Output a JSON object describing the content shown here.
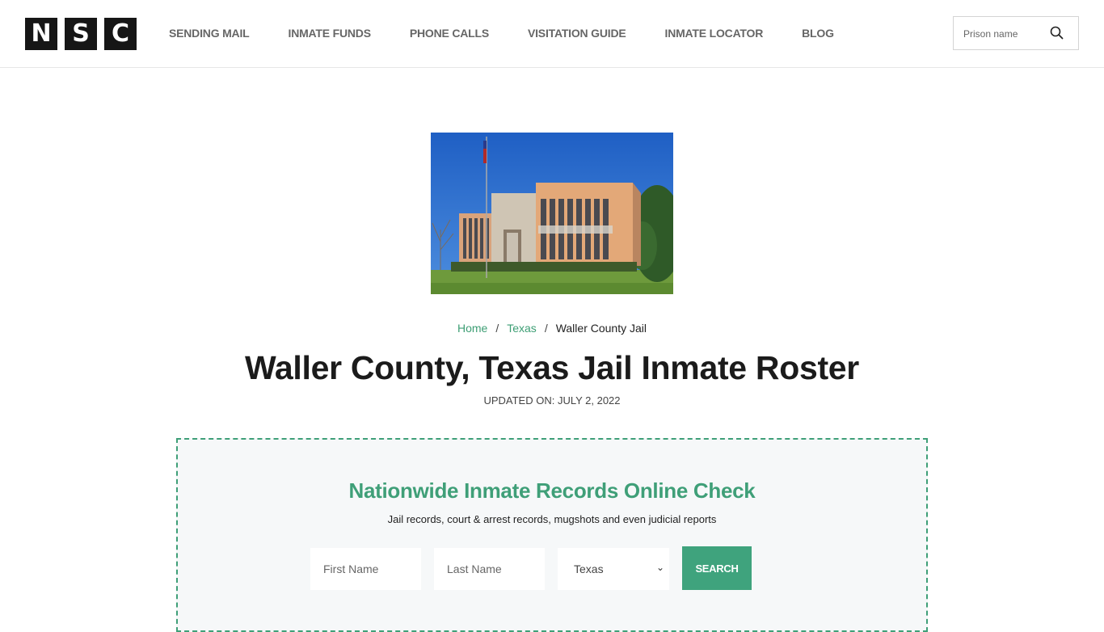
{
  "header": {
    "logo_letters": [
      "N",
      "S",
      "C"
    ],
    "nav": [
      {
        "label": "SENDING MAIL"
      },
      {
        "label": "INMATE FUNDS"
      },
      {
        "label": "PHONE CALLS"
      },
      {
        "label": "VISITATION GUIDE"
      },
      {
        "label": "INMATE LOCATOR"
      },
      {
        "label": "BLOG"
      }
    ],
    "search": {
      "placeholder": "Prison name",
      "icon": "search-icon"
    }
  },
  "hero": {
    "image_alt": "Waller County Jail building"
  },
  "breadcrumb": {
    "items": [
      {
        "label": "Home"
      },
      {
        "label": "Texas"
      },
      {
        "label": "Waller County Jail"
      }
    ],
    "separator": "/"
  },
  "page": {
    "title": "Waller County, Texas Jail Inmate Roster",
    "updated": "UPDATED ON: JULY 2, 2022"
  },
  "records": {
    "title": "Nationwide Inmate Records Online Check",
    "subtitle": "Jail records, court & arrest records, mugshots and even judicial reports",
    "first_name_placeholder": "First Name",
    "last_name_placeholder": "Last Name",
    "state_selected": "Texas",
    "search_label": "SEARCH"
  },
  "colors": {
    "accent": "#3fa37d",
    "logo_bg": "#161616",
    "link": "#3d9e74"
  }
}
